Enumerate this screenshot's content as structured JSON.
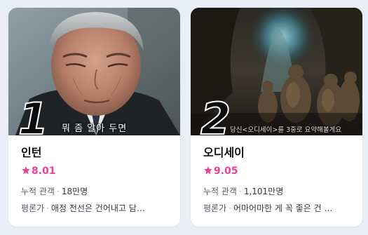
{
  "cards": [
    {
      "rank": "1",
      "subtitle": "뭐 좀 알아 두면",
      "title": "인턴",
      "rating": "8.01",
      "audience_label": "누적 관객",
      "audience_value": "18만명",
      "critic_label": "평론가",
      "critic_value": "애정 전선은 건어내고 담백..."
    },
    {
      "rank": "2",
      "subtitle": "당신<오디세이>를 3중로 요약해볼게요",
      "title": "오디세이",
      "rating": "9.05",
      "audience_label": "누적 관객",
      "audience_value": "1,101만명",
      "critic_label": "평론가",
      "critic_value": "어마어마한 게 꼭 좋은 건 아..."
    }
  ],
  "colors": {
    "rating": "#f03e9a",
    "background": "#e9eef6"
  },
  "icons": {
    "rating": "star-icon"
  }
}
